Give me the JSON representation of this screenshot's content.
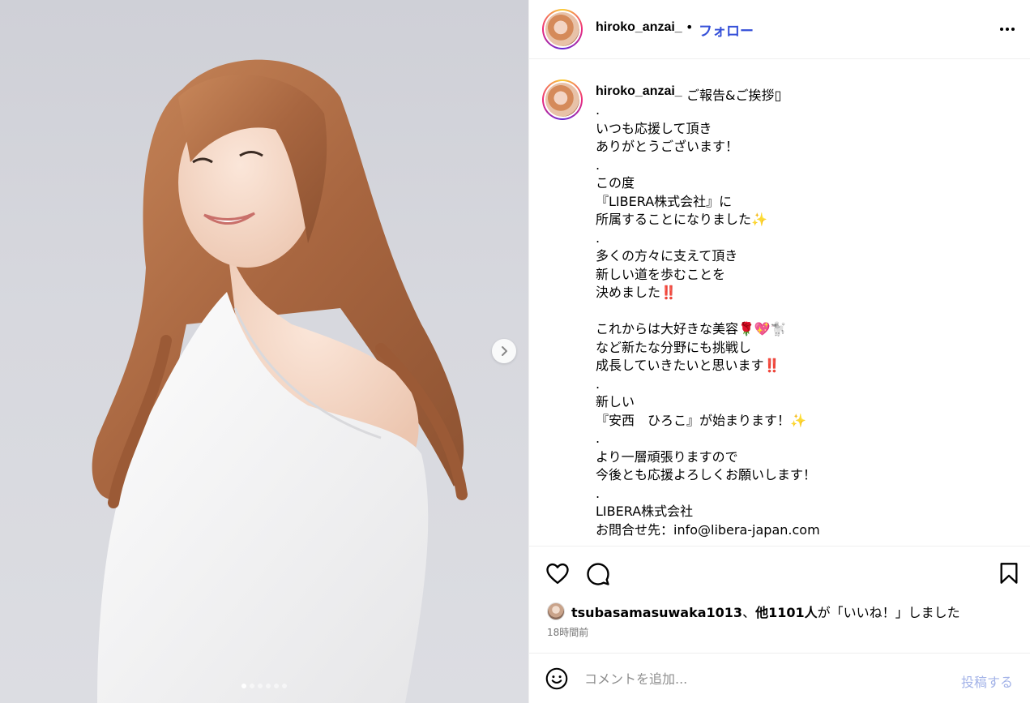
{
  "post": {
    "username": "hiroko_anzai_",
    "separator": "•",
    "follow_label": "フォロー",
    "more_icon": "more-horizontal-icon"
  },
  "caption": {
    "username": "hiroko_anzai_",
    "title": "ご報告&ご挨拶▯",
    "lines": [
      ".",
      "いつも応援して頂き",
      "ありがとうございます！",
      ".",
      "この度",
      "『LIBERA株式会社』に",
      "所属することになりました✨",
      ".",
      "多くの方々に支えて頂き",
      "新しい道を歩むことを",
      "決めました‼️",
      "",
      "これからは大好きな美容🌹💖🐩",
      "など新たな分野にも挑戦し",
      "成長していきたいと思います‼️",
      ".",
      "新しい",
      "『安西　ひろこ』が始まります！✨",
      ".",
      "より一層頑張りますので",
      "今後とも応援よろしくお願いします！",
      ".",
      "LIBERA株式会社",
      "お問合せ先：info@libera-japan.com"
    ]
  },
  "likes": {
    "user": "tsubasamasuwaka1013",
    "middle": "、",
    "others": "他1101人",
    "suffix": "が「いいね！」しました"
  },
  "timestamp": "18時間前",
  "comment": {
    "placeholder": "コメントを追加...",
    "post_label": "投稿する"
  },
  "carousel": {
    "total": 6,
    "active": 1
  },
  "colors": {
    "follow": "#3550d8",
    "post_disabled": "#a3b3e8",
    "muted": "#737373",
    "border": "#efefef"
  }
}
